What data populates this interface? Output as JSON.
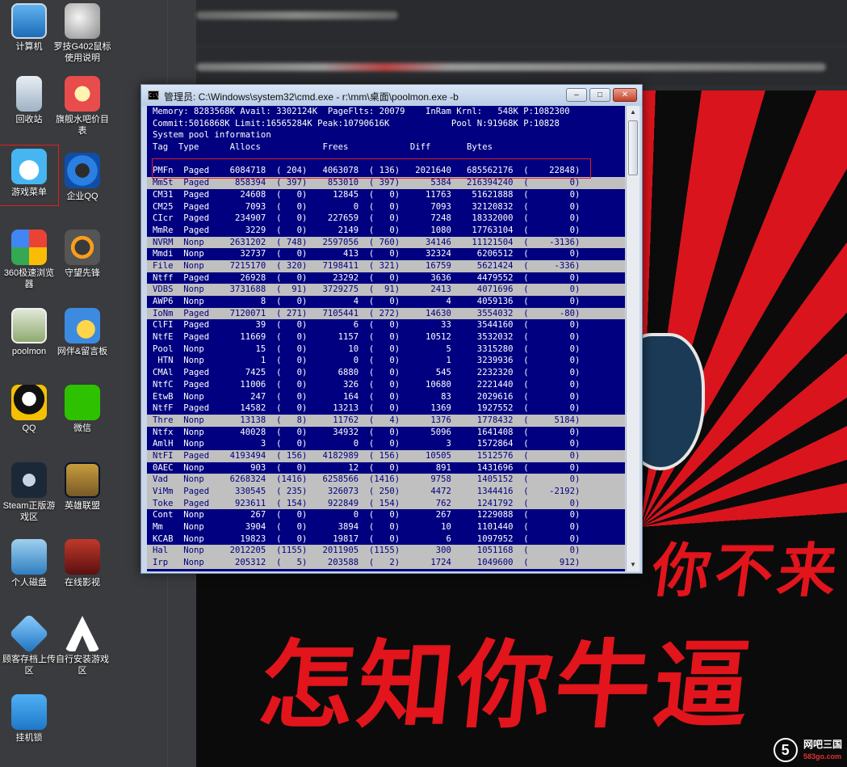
{
  "desktop": {
    "icons": [
      {
        "label": "计算机",
        "icon": "computer-icon"
      },
      {
        "label": "罗技G402鼠标使用说明",
        "icon": "mouse-icon"
      },
      {
        "label": "回收站",
        "icon": "recycle-bin-icon"
      },
      {
        "label": "旗舰水吧价目表",
        "icon": "drink-icon"
      },
      {
        "label": "游戏菜单",
        "icon": "cloud-game-icon"
      },
      {
        "label": "企业QQ",
        "icon": "enterprise-qq-icon"
      },
      {
        "label": "360极速浏览器",
        "icon": "browser-360-icon"
      },
      {
        "label": "守望先锋",
        "icon": "overwatch-icon"
      },
      {
        "label": "poolmon",
        "icon": "poolmon-icon"
      },
      {
        "label": "网伴&留言板",
        "icon": "chat-board-icon"
      },
      {
        "label": "QQ",
        "icon": "qq-icon"
      },
      {
        "label": "微信",
        "icon": "wechat-icon"
      },
      {
        "label": "Steam正版游戏区",
        "icon": "steam-icon"
      },
      {
        "label": "英雄联盟",
        "icon": "lol-icon"
      },
      {
        "label": "个人磁盘",
        "icon": "personal-disk-icon"
      },
      {
        "label": "在线影视",
        "icon": "online-video-icon"
      },
      {
        "label": "顾客存档上传区",
        "icon": "upload-cube-icon"
      },
      {
        "label": "自行安装游戏区",
        "icon": "assassin-icon"
      },
      {
        "label": "挂机锁",
        "icon": "lock-icon"
      }
    ]
  },
  "poster": {
    "line1": "你不来",
    "line2": "怎知你牛逼"
  },
  "watermark": {
    "logo": "5",
    "name": "网吧三国",
    "domain": "583go.com"
  },
  "cmd": {
    "title": "管理员: C:\\Windows\\system32\\cmd.exe - r:\\mm\\桌面\\poolmon.exe  -b",
    "app_icon": "C:\\",
    "buttons": {
      "minimize": "–",
      "maximize": "□",
      "close": "✕"
    },
    "scroll_up": "▲",
    "scroll_down": "▼",
    "header_lines": [
      "Memory: 8283568K Avail: 3302124K  PageFlts: 20079    InRam Krnl:   548K P:1082300",
      "Commit:5016868K Limit:16565284K Peak:10790616K            Pool N:91968K P:10828",
      "System pool information",
      "Tag  Type      Allocs            Frees            Diff       Bytes",
      ""
    ],
    "rows": [
      {
        "text": "PMFn  Paged    6084718  ( 204)   4063078  ( 136)   2021640   685562176  (    22848)",
        "highlight": false
      },
      {
        "text": "MmSt  Paged     858394  ( 397)    853010  ( 397)      5384   216394240  (        0)",
        "highlight": true
      },
      {
        "text": "CM31  Paged      24608  (   0)     12845  (   0)     11763    51621888  (        0)",
        "highlight": false
      },
      {
        "text": "CM25  Paged       7093  (   0)         0  (   0)      7093    32120832  (        0)",
        "highlight": false
      },
      {
        "text": "CIcr  Paged     234907  (   0)    227659  (   0)      7248    18332000  (        0)",
        "highlight": false
      },
      {
        "text": "MmRe  Paged       3229  (   0)      2149  (   0)      1080    17763104  (        0)",
        "highlight": false
      },
      {
        "text": "NVRM  Nonp     2631202  ( 748)   2597056  ( 760)     34146    11121504  (    -3136)",
        "highlight": true
      },
      {
        "text": "Mmdi  Nonp       32737  (   0)       413  (   0)     32324     6206512  (        0)",
        "highlight": false
      },
      {
        "text": "File  Nonp     7215170  ( 320)   7198411  ( 321)     16759     5621424  (     -336)",
        "highlight": true
      },
      {
        "text": "Ntff  Paged      26928  (   0)     23292  (   0)      3636     4479552  (        0)",
        "highlight": false
      },
      {
        "text": "VDBS  Nonp     3731688  (  91)   3729275  (  91)      2413     4071696  (        0)",
        "highlight": true
      },
      {
        "text": "AWP6  Nonp           8  (   0)         4  (   0)         4     4059136  (        0)",
        "highlight": false
      },
      {
        "text": "IoNm  Paged    7120071  ( 271)   7105441  ( 272)     14630     3554032  (      -80)",
        "highlight": true
      },
      {
        "text": "ClFI  Paged         39  (   0)         6  (   0)        33     3544160  (        0)",
        "highlight": false
      },
      {
        "text": "NtfE  Paged      11669  (   0)      1157  (   0)     10512     3532032  (        0)",
        "highlight": false
      },
      {
        "text": "Pool  Nonp          15  (   0)        10  (   0)         5     3315280  (        0)",
        "highlight": false
      },
      {
        "text": " HTN  Nonp           1  (   0)         0  (   0)         1     3239936  (        0)",
        "highlight": false
      },
      {
        "text": "CMAl  Paged       7425  (   0)      6880  (   0)       545     2232320  (        0)",
        "highlight": false
      },
      {
        "text": "NtfC  Paged      11006  (   0)       326  (   0)     10680     2221440  (        0)",
        "highlight": false
      },
      {
        "text": "EtwB  Nonp         247  (   0)       164  (   0)        83     2029616  (        0)",
        "highlight": false
      },
      {
        "text": "NtfF  Paged      14582  (   0)     13213  (   0)      1369     1927552  (        0)",
        "highlight": false
      },
      {
        "text": "Thre  Nonp       13138  (   8)     11762  (   4)      1376     1778432  (     5184)",
        "highlight": true
      },
      {
        "text": "Ntfx  Nonp       40028  (   0)     34932  (   0)      5096     1641408  (        0)",
        "highlight": false
      },
      {
        "text": "AmlH  Nonp           3  (   0)         0  (   0)         3     1572864  (        0)",
        "highlight": false
      },
      {
        "text": "NtFI  Paged    4193494  ( 156)   4182989  ( 156)     10505     1512576  (        0)",
        "highlight": true
      },
      {
        "text": "0AEC  Nonp         903  (   0)        12  (   0)       891     1431696  (        0)",
        "highlight": false
      },
      {
        "text": "Vad   Nonp     6268324  (1416)   6258566  (1416)      9758     1405152  (        0)",
        "highlight": true
      },
      {
        "text": "ViMm  Paged     330545  ( 235)    326073  ( 250)      4472     1344416  (    -2192)",
        "highlight": true
      },
      {
        "text": "Toke  Paged     923611  ( 154)    922849  ( 154)       762     1241792  (        0)",
        "highlight": true
      },
      {
        "text": "Cont  Nonp         267  (   0)         0  (   0)       267     1229088  (        0)",
        "highlight": false
      },
      {
        "text": "Mm    Nonp        3904  (   0)      3894  (   0)        10     1101440  (        0)",
        "highlight": false
      },
      {
        "text": "KCAB  Nonp       19823  (   0)     19817  (   0)         6     1097952  (        0)",
        "highlight": false
      },
      {
        "text": "Hal   Nonp     2012205  (1155)   2011905  (1155)       300     1051168  (        0)",
        "highlight": true
      },
      {
        "text": "Irp   Nonp      205312  (   5)    203588  (   2)      1724     1049600  (      912)",
        "highlight": true
      }
    ]
  }
}
